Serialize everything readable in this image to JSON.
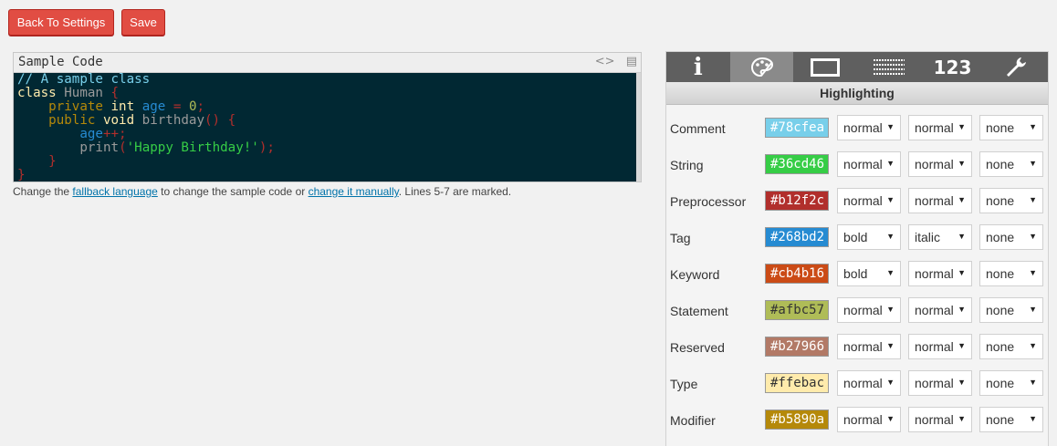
{
  "toolbar": {
    "back_label": "Back To Settings",
    "save_label": "Save"
  },
  "sample": {
    "title": "Sample Code",
    "help_prefix": "Change the ",
    "help_link1": "fallback language",
    "help_mid": " to change the sample code or ",
    "help_link2": "change it manually",
    "help_suffix": ". Lines 5-7 are marked.",
    "code": {
      "line1": "// A sample class",
      "l2_kw": "class",
      "l2_name": " Human ",
      "l2_brace": "{",
      "l3_mod": "private",
      "l3_type": " int ",
      "l3_var": "age",
      "l3_eq": " = ",
      "l3_num": "0",
      "l3_semi": ";",
      "l4_mod": "public",
      "l4_type": " void ",
      "l4_name": "birthday",
      "l4_paren": "()",
      "l4_brace": " {",
      "l5_var": "age",
      "l5_op": "++;",
      "l6_fn": "print",
      "l6_open": "(",
      "l6_str": "'Happy Birthday!'",
      "l6_close": ");",
      "l7_brace": "}",
      "l8_brace": "}"
    }
  },
  "theme": {
    "tabs": [
      {
        "label": "i",
        "icon": "info-icon"
      },
      {
        "label": "",
        "icon": "palette-icon"
      },
      {
        "label": "",
        "icon": "frame-icon"
      },
      {
        "label": "",
        "icon": "lines-icon"
      },
      {
        "label": "123",
        "icon": "numbers-icon"
      },
      {
        "label": "",
        "icon": "wrench-icon"
      }
    ],
    "section_title": "Highlighting",
    "rows": [
      {
        "label": "Comment",
        "color": "#78cfea",
        "text_color": "#ffffff",
        "weight": "normal",
        "style": "normal",
        "decoration": "none"
      },
      {
        "label": "String",
        "color": "#36cd46",
        "text_color": "#ffffff",
        "weight": "normal",
        "style": "normal",
        "decoration": "none"
      },
      {
        "label": "Preprocessor",
        "color": "#b12f2c",
        "text_color": "#ffffff",
        "weight": "normal",
        "style": "normal",
        "decoration": "none"
      },
      {
        "label": "Tag",
        "color": "#268bd2",
        "text_color": "#ffffff",
        "weight": "bold",
        "style": "italic",
        "decoration": "none"
      },
      {
        "label": "Keyword",
        "color": "#cb4b16",
        "text_color": "#ffffff",
        "weight": "bold",
        "style": "normal",
        "decoration": "none"
      },
      {
        "label": "Statement",
        "color": "#afbc57",
        "text_color": "#333333",
        "weight": "normal",
        "style": "normal",
        "decoration": "none"
      },
      {
        "label": "Reserved",
        "color": "#b27966",
        "text_color": "#ffffff",
        "weight": "normal",
        "style": "normal",
        "decoration": "none"
      },
      {
        "label": "Type",
        "color": "#ffebac",
        "text_color": "#333333",
        "weight": "normal",
        "style": "normal",
        "decoration": "none"
      },
      {
        "label": "Modifier",
        "color": "#b5890a",
        "text_color": "#ffffff",
        "weight": "normal",
        "style": "normal",
        "decoration": "none"
      }
    ]
  }
}
